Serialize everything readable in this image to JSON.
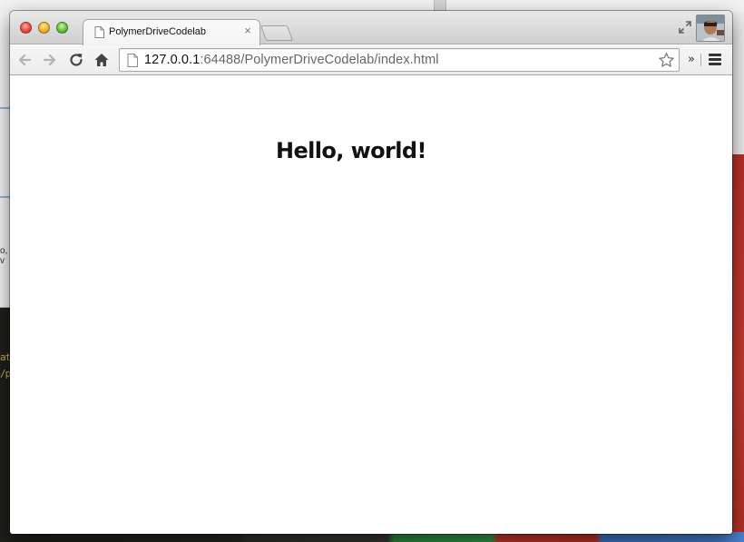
{
  "browser": {
    "tab": {
      "title": "PolymerDriveCodelab",
      "close_glyph": "×",
      "favicon": "page-icon"
    },
    "toolbar": {
      "back_icon": "back-arrow-icon",
      "forward_icon": "forward-arrow-icon",
      "reload_icon": "reload-icon",
      "home_icon": "home-icon",
      "overflow_glyph": "»",
      "menu_icon": "hamburger-menu-icon"
    },
    "omnibox": {
      "url_host": "127.0.0.1",
      "url_rest": ":64488/PolymerDriveCodelab/index.html",
      "bookmark_icon": "star-icon"
    },
    "window_controls": [
      "close",
      "minimize",
      "maximize"
    ],
    "fullscreen_icon": "fullscreen-icon"
  },
  "page": {
    "heading": "Hello, world!"
  },
  "background_windows": {
    "left_text": "o, v",
    "editor_lines": [
      "at",
      "/p"
    ]
  },
  "colors": {
    "accent_close": "#f0564a",
    "accent_minimize": "#f5b934",
    "accent_maximize": "#72c94c",
    "url_host": "#111111",
    "url_rest": "#666666"
  }
}
